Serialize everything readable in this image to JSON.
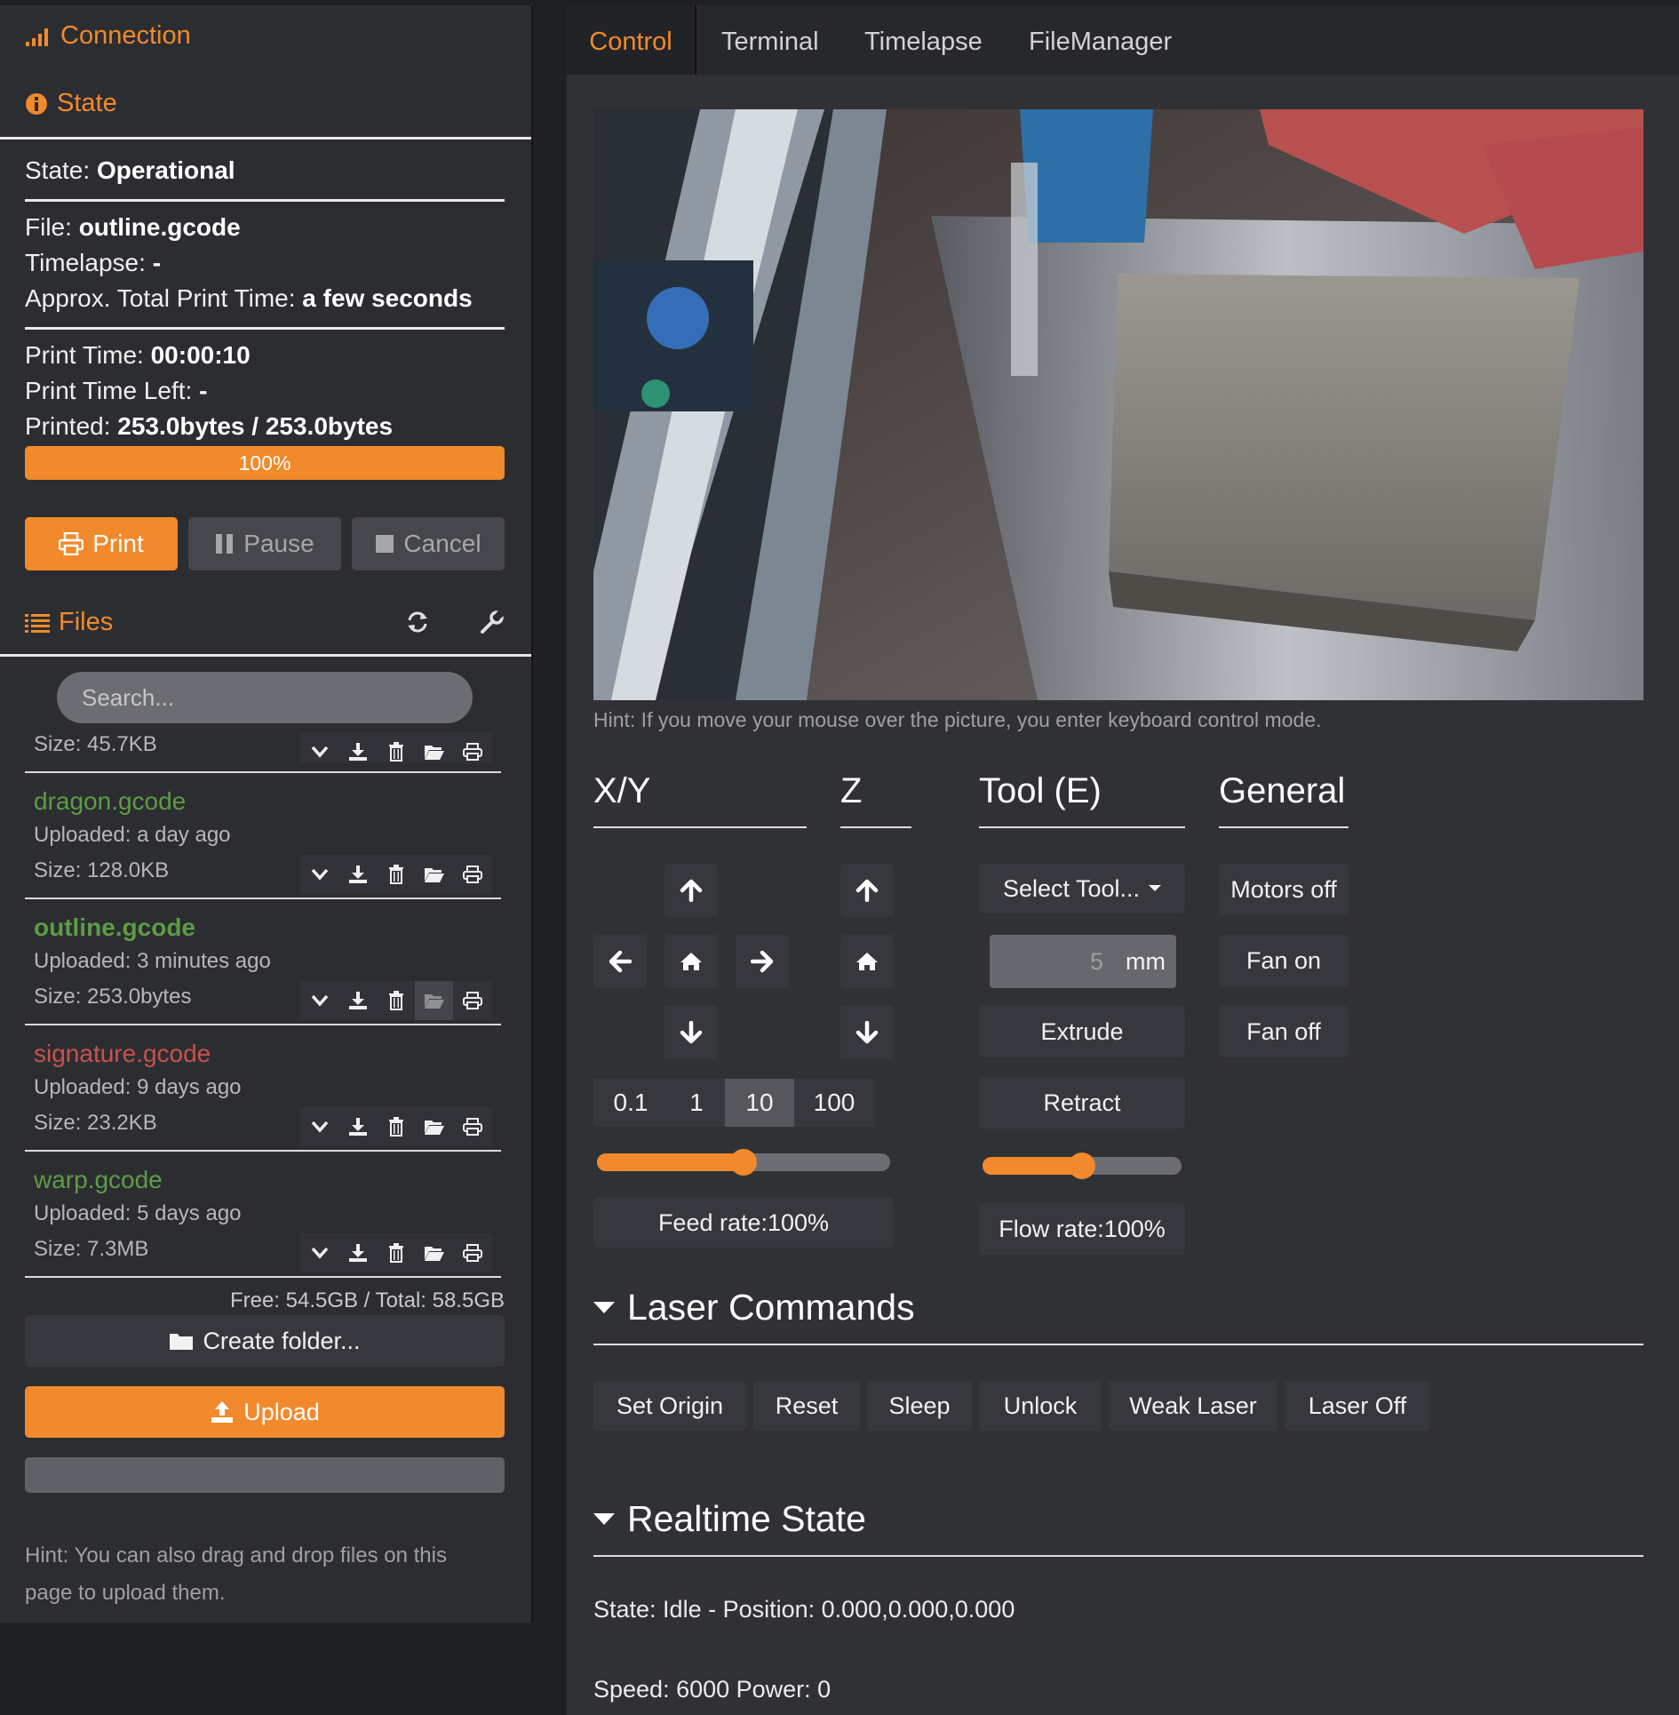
{
  "sidebar": {
    "connection_label": "Connection",
    "state_label": "State",
    "state": {
      "label": "State:",
      "value": "Operational"
    },
    "file": {
      "label": "File:",
      "value": "outline.gcode"
    },
    "timelapse": {
      "label": "Timelapse:",
      "value": "-"
    },
    "approx_time": {
      "label": "Approx. Total Print Time:",
      "value": "a few seconds"
    },
    "print_time": {
      "label": "Print Time:",
      "value": "00:00:10"
    },
    "print_time_left": {
      "label": "Print Time Left:",
      "value": "-"
    },
    "printed": {
      "label": "Printed:",
      "value": "253.0bytes / 253.0bytes"
    },
    "progress": {
      "percent": 100,
      "label": "100%"
    },
    "buttons": {
      "print": "Print",
      "pause": "Pause",
      "cancel": "Cancel"
    },
    "files_label": "Files",
    "search_placeholder": "Search...",
    "partial_file_size": "Size: 45.7KB",
    "files": [
      {
        "name": "dragon.gcode",
        "uploaded": "Uploaded: a day ago",
        "size": "Size: 128.0KB",
        "status": "success"
      },
      {
        "name": "outline.gcode",
        "uploaded": "Uploaded: 3 minutes ago",
        "size": "Size: 253.0bytes",
        "status": "selected"
      },
      {
        "name": "signature.gcode",
        "uploaded": "Uploaded: 9 days ago",
        "size": "Size: 23.2KB",
        "status": "failed"
      },
      {
        "name": "warp.gcode",
        "uploaded": "Uploaded: 5 days ago",
        "size": "Size: 7.3MB",
        "status": "success"
      }
    ],
    "free_space": "Free: 54.5GB / Total: 58.5GB",
    "create_folder": "Create folder...",
    "upload": "Upload",
    "hint_line1": "Hint: You can also drag and drop files on this",
    "hint_line2": "page to upload them."
  },
  "tabs": [
    "Control",
    "Terminal",
    "Timelapse",
    "FileManager"
  ],
  "active_tab": "Control",
  "control": {
    "webcam_hint": "Hint: If you move your mouse over the picture, you enter keyboard control mode.",
    "xy_title": "X/Y",
    "z_title": "Z",
    "tool_title": "Tool (E)",
    "general_title": "General",
    "step_sizes": [
      "0.1",
      "1",
      "10",
      "100"
    ],
    "active_step": "10",
    "feed_rate_label": "Feed rate:100%",
    "feed_rate_value": 50,
    "select_tool": "Select Tool...",
    "extrude_amount": "5",
    "extrude_unit": "mm",
    "extrude": "Extrude",
    "retract": "Retract",
    "flow_rate_label": "Flow rate:100%",
    "flow_rate_value": 50,
    "motors_off": "Motors off",
    "fan_on": "Fan on",
    "fan_off": "Fan off"
  },
  "laser": {
    "title": "Laser Commands",
    "buttons": [
      "Set Origin",
      "Reset",
      "Sleep",
      "Unlock",
      "Weak Laser",
      "Laser Off"
    ]
  },
  "realtime": {
    "title": "Realtime State",
    "state_line": "State: Idle - Position: 0.000,0.000,0.000",
    "speed_line": "Speed: 6000 Power: 0"
  },
  "colors": {
    "accent": "#f18a2c",
    "success_file": "#5d9c45",
    "failed_file": "#c9524e",
    "selected_file": "#5d9c45"
  }
}
